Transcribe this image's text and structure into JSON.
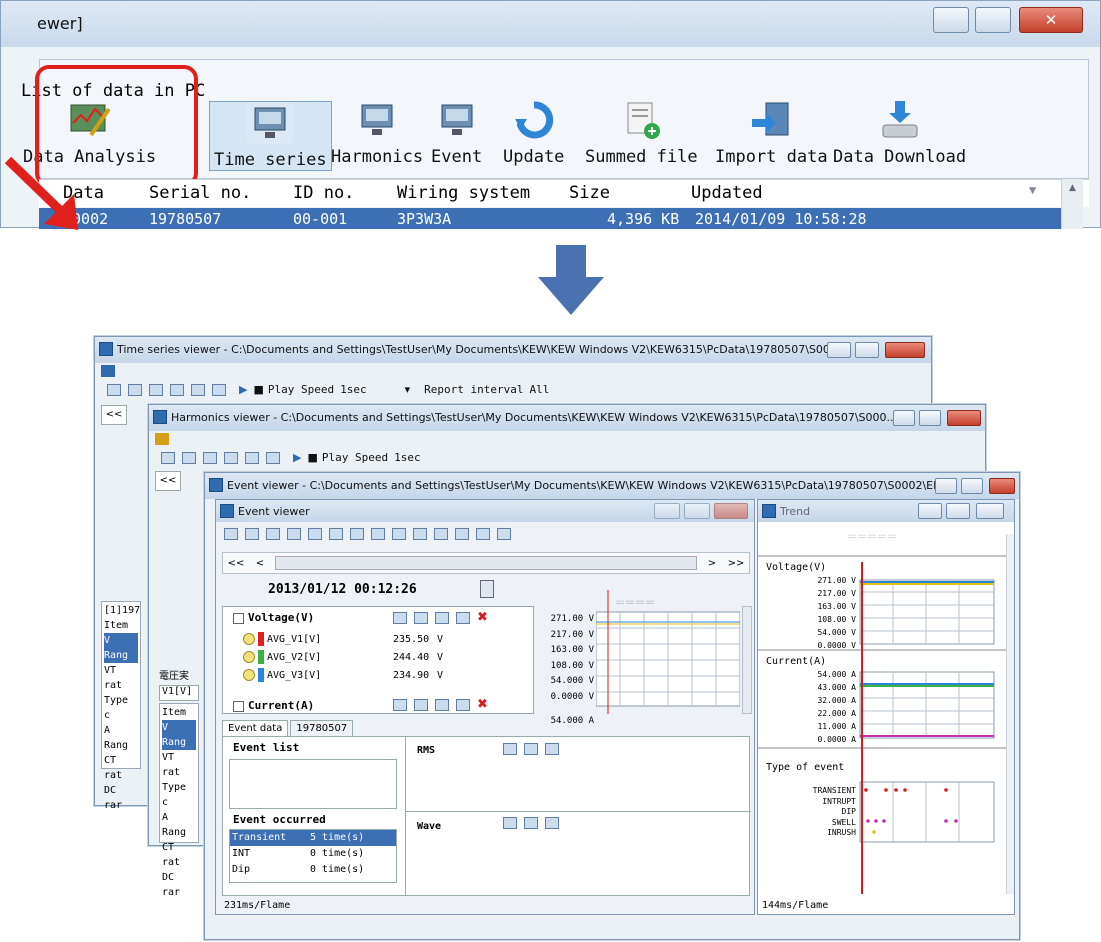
{
  "top_window": {
    "title_fragment": "ewer]",
    "caption": "List of data in PC",
    "tools": [
      {
        "label": "Data Analysis",
        "icon": "data-analysis-icon"
      },
      {
        "label": "Time series",
        "icon": "monitor-icon"
      },
      {
        "label": "Harmonics",
        "icon": "monitor-icon"
      },
      {
        "label": "Event",
        "icon": "monitor-icon"
      },
      {
        "label": "Update",
        "icon": "refresh-icon"
      },
      {
        "label": "Summed file",
        "icon": "add-file-icon"
      },
      {
        "label": "Import data",
        "icon": "import-icon"
      },
      {
        "label": "Data Download",
        "icon": "download-icon"
      }
    ],
    "columns": [
      "Data",
      "Serial no.",
      "ID no.",
      "Wiring system",
      "Size",
      "Updated"
    ],
    "selected_row": [
      "S0002",
      "19780507",
      "00-001",
      "3P3W3A",
      "4,396 KB",
      "2014/01/09 10:58:28"
    ],
    "highlight_color": "#e0201c"
  },
  "time_series_viewer": {
    "title": "Time series viewer - C:\\Documents and Settings\\TestUser\\My Documents\\KEW\\KEW Windows V2\\KEW6315\\PcData\\19780507\\S000...",
    "toolbar": {
      "play_speed_label": "Play Speed",
      "play_speed_value": "1sec",
      "report_label": "Report interval",
      "report_value": "All"
    },
    "nav_left": "<<",
    "item_rows": [
      "[1]197",
      "Item",
      "V Rang",
      "VT rat",
      "Type c",
      "A Rang",
      "CT rat",
      "DC rar"
    ]
  },
  "harmonics_viewer": {
    "title": "Harmonics viewer - C:\\Documents and Settings\\TestUser\\My Documents\\KEW\\KEW Windows V2\\KEW6315\\PcData\\19780507\\S000...",
    "toolbar": {
      "play_speed_label": "Play Speed",
      "play_speed_value": "1sec"
    },
    "nav_left": "<<",
    "label_jp": "電圧実",
    "tab": "V1[V]",
    "item_rows": [
      "Item",
      "V Rang",
      "VT rat",
      "Type c",
      "A Rang",
      "CT rat",
      "DC rar"
    ]
  },
  "event_outer": {
    "title": "Event viewer - C:\\Documents and Settings\\TestUser\\My Documents\\KEW\\KEW Windows V2\\KEW6315\\PcData\\19780507\\S0002\\EP..."
  },
  "event_viewer": {
    "title": "Event viewer",
    "nav": [
      "<<",
      "<",
      ">",
      ">>"
    ],
    "timestamp": "2013/01/12 00:12:26",
    "voltage_group": "Voltage(V)",
    "voltage_rows": [
      {
        "name": "AVG_V1[V]",
        "value": "235.50",
        "unit": "V",
        "color": "#e0201c"
      },
      {
        "name": "AVG_V2[V]",
        "value": "244.40",
        "unit": "V",
        "color": "#3cb043"
      },
      {
        "name": "AVG_V3[V]",
        "value": "234.90",
        "unit": "V",
        "color": "#2b86d6"
      }
    ],
    "current_group": "Current(A)",
    "voltage_ticks": [
      "271.00 V",
      "217.00 V",
      "163.00 V",
      "108.00 V",
      "54.000 V",
      "0.0000 V"
    ],
    "current_tick_top": "54.000 A",
    "tabs": [
      "Event data",
      "19780507"
    ],
    "event_list_label": "Event list",
    "rms_label": "RMS",
    "event_occurred_label": "Event occurred",
    "wave_label": "Wave",
    "occurrences": [
      {
        "type": "Transient",
        "count": "5 time(s)"
      },
      {
        "type": "INT",
        "count": "0 time(s)"
      },
      {
        "type": "Dip",
        "count": "0 time(s)"
      }
    ],
    "status": "231ms/Flame"
  },
  "trend_panel": {
    "title": "Trend",
    "voltage_title": "Voltage(V)",
    "voltage_ticks": [
      "271.00 V",
      "217.00 V",
      "163.00 V",
      "108.00 V",
      "54.000 V",
      "0.0000 V"
    ],
    "current_title": "Current(A)",
    "current_ticks": [
      "54.000 A",
      "43.000 A",
      "32.000 A",
      "22.000 A",
      "11.000 A",
      "0.0000 A"
    ],
    "event_type_title": "Type of event",
    "event_types": [
      "TRANSIENT",
      "INTRUPT",
      "DIP",
      "SWELL",
      "INRUSH"
    ],
    "status": "144ms/Flame"
  },
  "colors": {
    "selection": "#3d6fb5",
    "cursor_line": "#d81b1b",
    "green": "#3cb043",
    "yellow": "#e8c21a",
    "blue": "#2b86d6",
    "magenta": "#c22fb3"
  }
}
